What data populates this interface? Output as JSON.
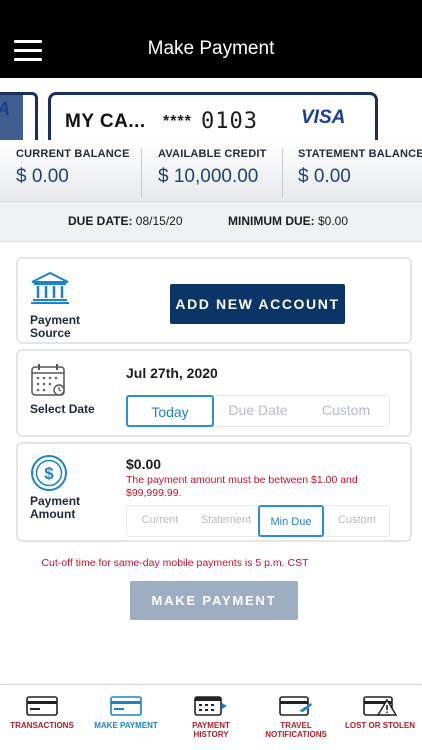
{
  "header": {
    "title": "Make Payment",
    "menu_icon": "hamburger-menu-icon"
  },
  "card": {
    "prev_logo_fragment": "A",
    "name": "MY CA...",
    "masked": "****",
    "last_digits": "0103",
    "network": "VISA",
    "border_color": "#1b2f5c",
    "logo_color": "#1a3f93"
  },
  "balances": [
    {
      "label": "CURRENT BALANCE",
      "value": "$ 0.00"
    },
    {
      "label": "AVAILABLE CREDIT",
      "value": "$ 10,000.00"
    },
    {
      "label": "STATEMENT BALANCE",
      "value": "$ 0.00"
    }
  ],
  "due": {
    "due_date_label": "DUE DATE:",
    "due_date_value": "08/15/20",
    "min_due_label": "MINIMUM DUE:",
    "min_due_value": "$0.00"
  },
  "payment_source": {
    "label_line1": "Payment",
    "label_line2": "Source",
    "icon": "bank-icon",
    "button": "ADD NEW ACCOUNT"
  },
  "select_date": {
    "label": "Select Date",
    "icon": "calendar-icon",
    "selected_date": "Jul 27th, 2020",
    "options": [
      "Today",
      "Due Date",
      "Custom"
    ],
    "selected": "Today"
  },
  "payment_amount": {
    "label_line1": "Payment",
    "label_line2": "Amount",
    "icon": "dollar-coin-icon",
    "amount": "$0.00",
    "error": "The payment amount must be between $1.00 and $99,999.99.",
    "options": [
      "Current",
      "Statement",
      "Min Due",
      "Custom"
    ],
    "selected": "Min Due"
  },
  "cutoff_note": "Cut-off time for same-day mobile payments is 5 p.m. CST",
  "submit_button": "MAKE PAYMENT",
  "tabs": [
    {
      "label_line1": "TRANSACTIONS",
      "label_line2": "",
      "icon": "card-list-icon",
      "active": false
    },
    {
      "label_line1": "MAKE PAYMENT",
      "label_line2": "",
      "icon": "card-payment-icon",
      "active": true
    },
    {
      "label_line1": "PAYMENT",
      "label_line2": "HISTORY",
      "icon": "payment-history-icon",
      "active": false
    },
    {
      "label_line1": "TRAVEL",
      "label_line2": "NOTIFICATIONS",
      "icon": "travel-plane-icon",
      "active": false
    },
    {
      "label_line1": "LOST OR STOLEN",
      "label_line2": "",
      "icon": "card-warning-icon",
      "active": false
    }
  ],
  "colors": {
    "primary_navy": "#0a3566",
    "accent_blue": "#1b84c6",
    "error_red": "#c8102e",
    "tab_red": "#b21e28",
    "disabled_button": "#9eaec2"
  }
}
